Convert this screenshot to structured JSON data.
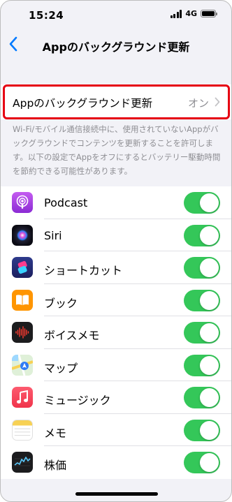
{
  "status_bar": {
    "time": "15:24",
    "network": "4G"
  },
  "nav": {
    "title": "Appのバックグラウンド更新"
  },
  "main_setting": {
    "label": "Appのバックグラウンド更新",
    "value": "オン"
  },
  "description": "Wi-Fi/モバイル通信接続中に、使用されていないAppがバックグラウンドでコンテンツを更新することを許可します。以下の設定でAppをオフにするとバッテリー駆動時間を節約できる可能性があります。",
  "colors": {
    "toggle_on": "#34c759",
    "highlight": "#e60012",
    "ios_blue": "#007aff"
  },
  "apps": [
    {
      "name": "Podcast",
      "icon": "podcast-icon",
      "enabled": true
    },
    {
      "name": "Siri",
      "icon": "siri-icon",
      "enabled": true
    },
    {
      "name": "ショートカット",
      "icon": "shortcuts-icon",
      "enabled": true
    },
    {
      "name": "ブック",
      "icon": "books-icon",
      "enabled": true
    },
    {
      "name": "ボイスメモ",
      "icon": "voice-memo-icon",
      "enabled": true
    },
    {
      "name": "マップ",
      "icon": "maps-icon",
      "enabled": true
    },
    {
      "name": "ミュージック",
      "icon": "music-icon",
      "enabled": true
    },
    {
      "name": "メモ",
      "icon": "notes-icon",
      "enabled": true
    },
    {
      "name": "株価",
      "icon": "stocks-icon",
      "enabled": true
    }
  ]
}
